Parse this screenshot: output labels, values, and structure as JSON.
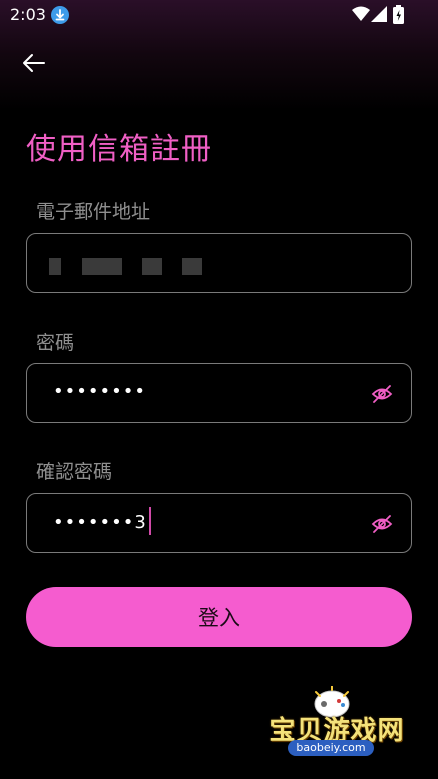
{
  "status_bar": {
    "time": "2:03"
  },
  "header": {
    "back_icon": "arrow-left-icon",
    "title": "使用信箱註冊"
  },
  "form": {
    "email": {
      "label": "電子郵件地址",
      "value": ""
    },
    "password": {
      "label": "密碼",
      "value": "••••••••",
      "toggle_icon": "eye-off-icon"
    },
    "confirm_password": {
      "label": "確認密碼",
      "value": "•••••••3",
      "toggle_icon": "eye-off-icon"
    },
    "submit_label": "登入"
  },
  "watermark": {
    "text": "宝贝游戏网",
    "url": "baobeiy.com"
  },
  "colors": {
    "accent": "#f05fc5",
    "button": "#f55ccf",
    "field_border": "#7a7a7a",
    "label": "#8f8f8f",
    "background": "#000000"
  }
}
